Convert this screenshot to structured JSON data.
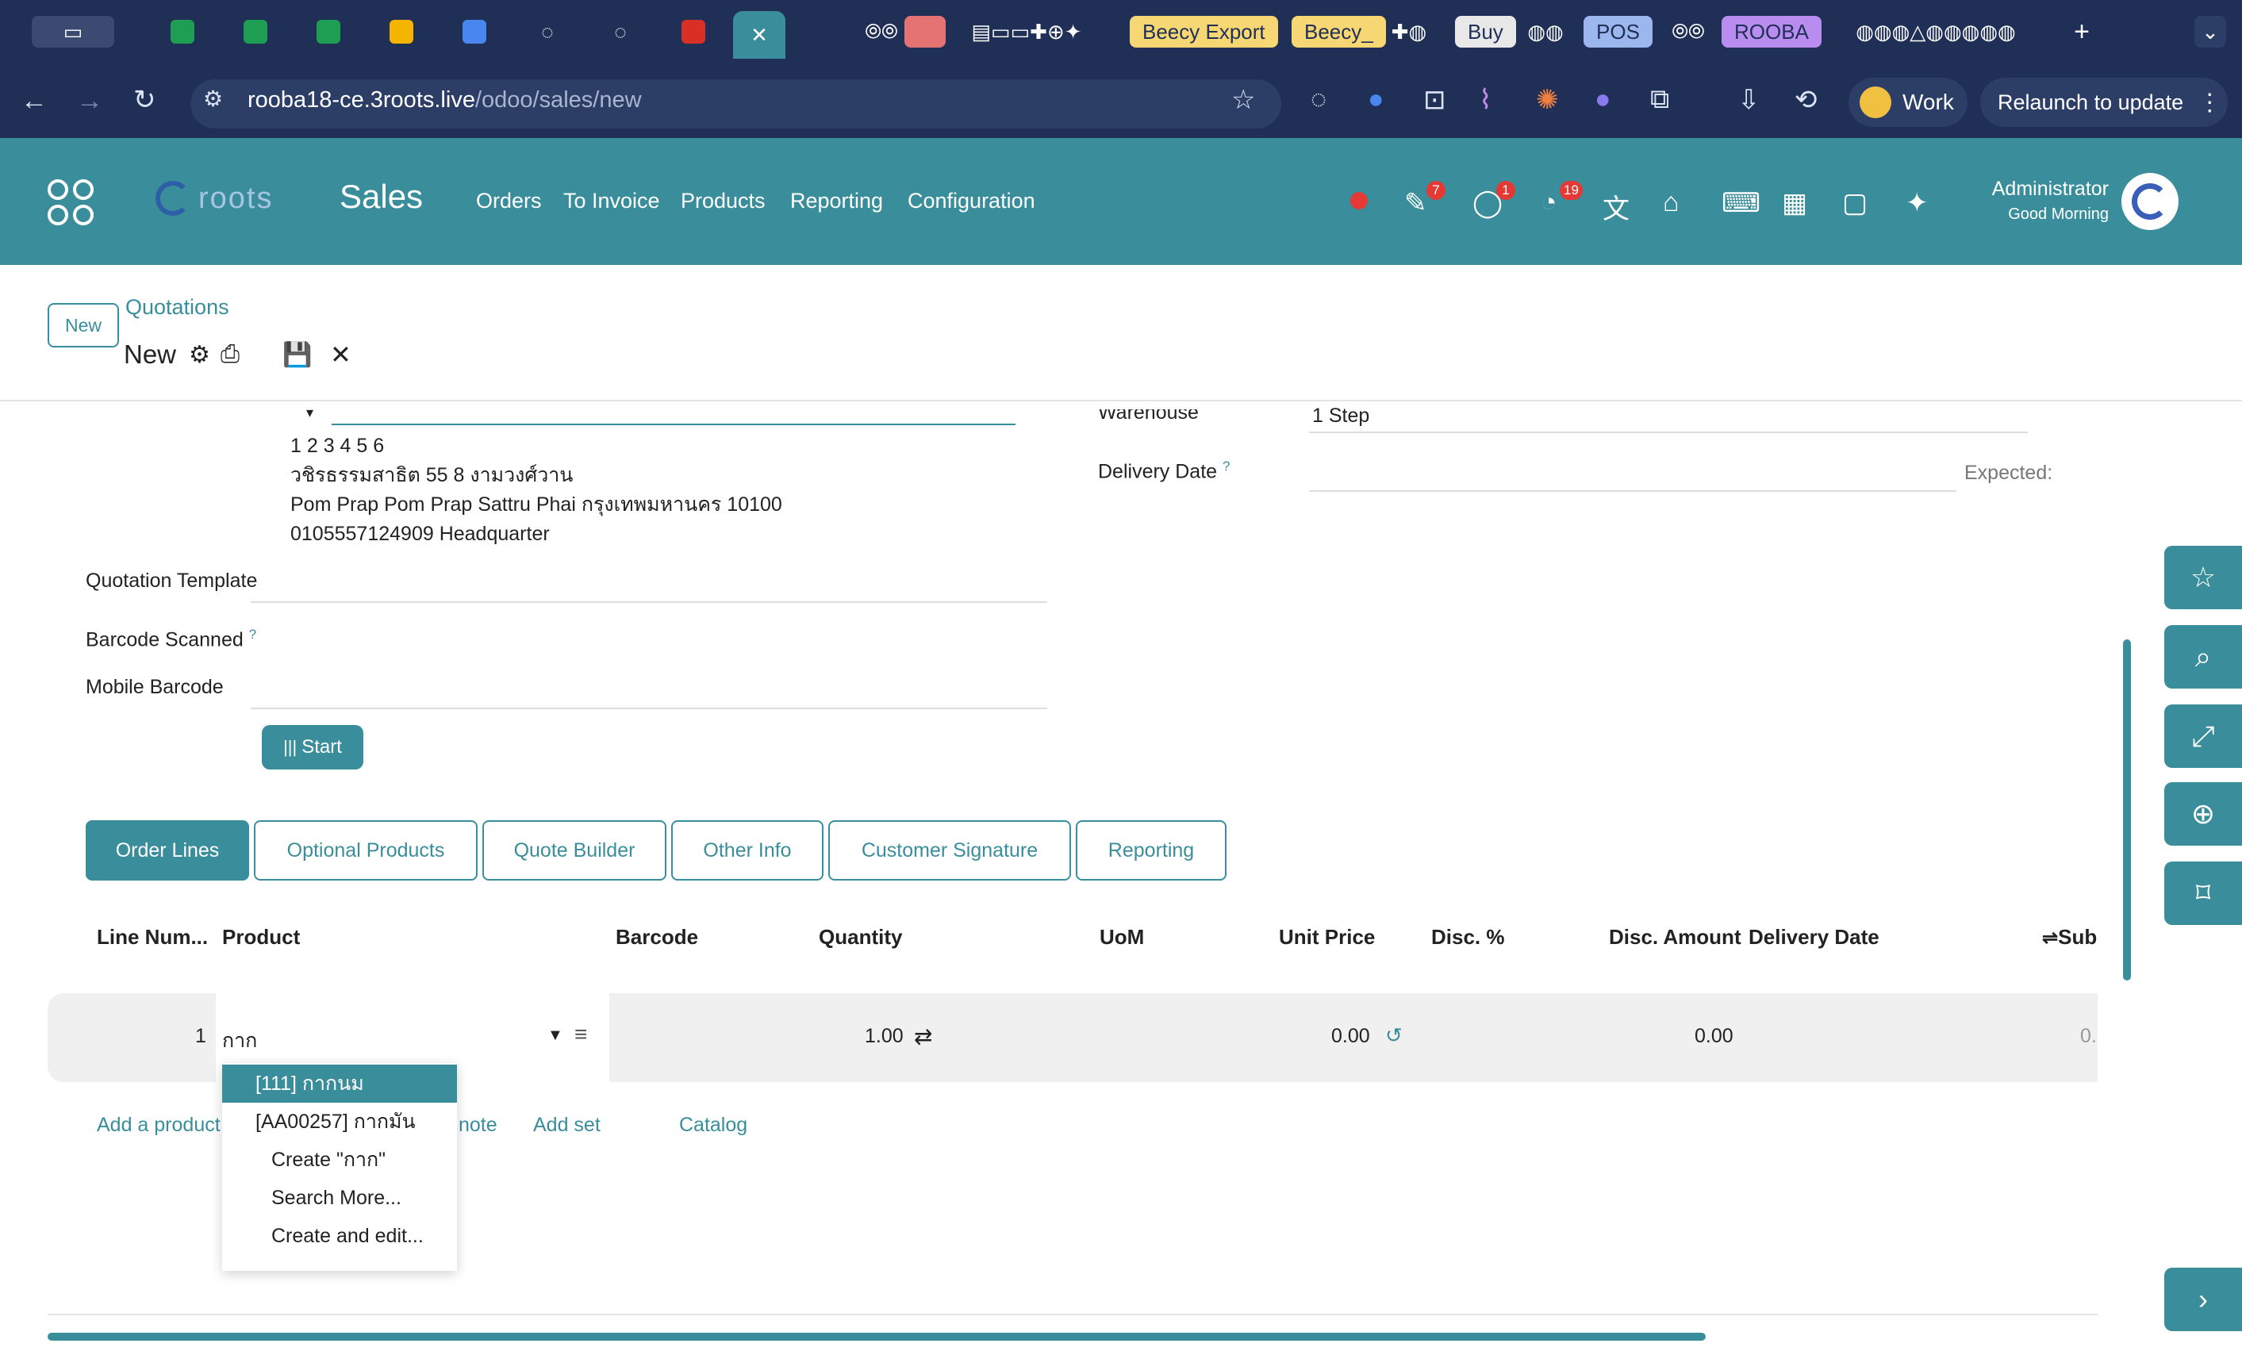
{
  "browser": {
    "tab_labels": [
      "Beecy Export",
      "Beecy_",
      "Buy",
      "POS",
      "ROOBA"
    ],
    "url_host": "rooba18-ce.3roots.live",
    "url_path": "/odoo/sales/new",
    "profile_label": "Work",
    "relaunch_label": "Relaunch to update"
  },
  "header": {
    "brand": "roots",
    "app_name": "Sales",
    "menu": [
      "Orders",
      "To Invoice",
      "Products",
      "Reporting",
      "Configuration"
    ],
    "badges": {
      "activities": "7",
      "messages": "1",
      "timer": "19"
    },
    "user_name": "Administrator",
    "greeting": "Good Morning"
  },
  "control": {
    "new_button": "New",
    "breadcrumb": "Quotations",
    "record_title": "New"
  },
  "form": {
    "address_lines": [
      "1 2 3 4 5 6",
      "วชิรธรรมสาธิต 55 8 งามวงศ์วาน",
      "Pom Prap Pom Prap Sattru Phai กรุงเทพมหานคร 10100",
      "0105557124909 Headquarter"
    ],
    "quotation_template_label": "Quotation Template",
    "barcode_scanned_label": "Barcode Scanned",
    "mobile_barcode_label": "Mobile Barcode",
    "start_button": "Start",
    "warehouse_label": "Warehouse",
    "warehouse_value": "1 Step",
    "delivery_date_label": "Delivery Date",
    "expected_label": "Expected:",
    "help_mark": "?"
  },
  "tabs": [
    "Order Lines",
    "Optional Products",
    "Quote Builder",
    "Other Info",
    "Customer Signature",
    "Reporting"
  ],
  "order_lines": {
    "columns": [
      "Line Num...",
      "Product",
      "Barcode",
      "Quantity",
      "UoM",
      "Unit Price",
      "Disc. %",
      "Disc. Amount",
      "Delivery Date",
      "Sub"
    ],
    "row": {
      "line_num": "1",
      "product_input": "กาก",
      "quantity": "1.00",
      "unit_price": "0.00",
      "disc_amount": "0.00",
      "subtotal": "0."
    },
    "actions": [
      "Add a product",
      "note",
      "Add set",
      "Catalog"
    ]
  },
  "dropdown": {
    "items": [
      "[111] กากนม",
      "[AA00257] กากมัน",
      "Create \"กาก\"",
      "Search More...",
      "Create and edit..."
    ]
  },
  "colors": {
    "accent": "#3a8e9b",
    "browser_chrome": "#1f2f55",
    "badge_red": "#e53935"
  }
}
